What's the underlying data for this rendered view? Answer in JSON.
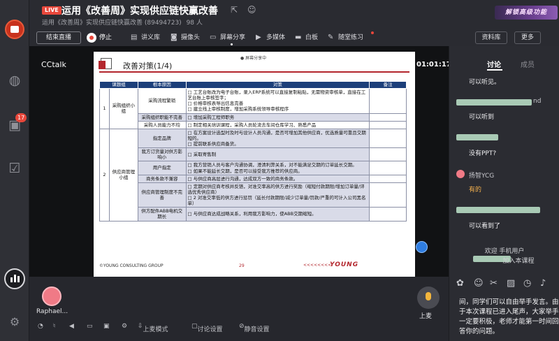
{
  "rail": {
    "badge_count": "17"
  },
  "header": {
    "live_badge": "LIVE",
    "title": "运用《改善周》实现供应链快赢改善",
    "subtitle": "运用《改善周》实现供应链快赢改善 (89494723)",
    "member_count": "98 人",
    "unlock_label": "解锁高级功能"
  },
  "toolbar": {
    "end_live": "结束直播",
    "stop": "停止",
    "courseware": "讲义库",
    "camera": "摄像头",
    "screen_share": "屏幕分享",
    "multimedia": "多媒体",
    "whiteboard": "白板",
    "quiz": "随堂练习",
    "library": "资料库",
    "more": "更多"
  },
  "stage": {
    "brand": "CCtalk",
    "timer": "01:01:17"
  },
  "slide": {
    "title": "改善对策(1/4)",
    "tag": "● 屏幕分享中",
    "headers": [
      "课题组",
      "根本原因",
      "对策",
      "备注"
    ],
    "rows": [
      {
        "group_no": "1",
        "group": "采购组织小组",
        "cause": "采购流程繁琐",
        "actions": [
          "工艺台账改为电子台账，录入ERP系统可以直接复制粘贴，无需物资审核单，直接在工艺台账上审核签字；",
          "价格审核表导出信息完善",
          "建立线上审核制度，增加采购系统领导审核程序"
        ]
      },
      {
        "cause": "采购组织职能不完善",
        "actions": [
          "增加采购工程师职务"
        ]
      },
      {
        "cause": "采购人员能力不均",
        "actions": [
          "制定相关培训课程，采购人员轮流去车间仓库学习、熟悉产品"
        ]
      },
      {
        "group_no": "2",
        "group": "供应商管理小组",
        "cause": "指定品牌",
        "actions": [
          "在方案设计选型时及时与设计人员沟通，是否可增加其他供应商，优选质量可靠且交期短的。",
          "提前联系供应商备货。"
        ]
      },
      {
        "cause": "我方订货量对供方影响小",
        "actions": [
          "采取寄售制"
        ]
      },
      {
        "cause": "用户指定",
        "actions": [
          "我方营销人员与客户沟通协调，澄清利弊关系，对不能满足交期的订单延长交期。",
          "如果不能延长交期，是否可以接受我方推荐的供应商。"
        ]
      },
      {
        "cause": "商务条款不兼容",
        "actions": [
          "与供应商高层进行沟通，达成双方一致的商务条款。"
        ]
      },
      {
        "cause": "供应商管理制度不完善",
        "actions": [
          "定期对供应商考核并反馈，对准交率高的供方进行奖励（缩短付款期限/增加订单量/评选优秀供应商）",
          "2 对准交率低的供方进行惩罚（延长付款期限/减少订单量/罚款/严重的可计入公司黑名单）"
        ]
      },
      {
        "cause": "供方配件ABB电机交期长",
        "actions": [
          "与供应商达成战略关系，利用我方影响力，使ABB交期缩短。"
        ]
      }
    ],
    "footer_left": "©YOUNG CONSULTING GROUP",
    "page_no": "29",
    "chevrons": "<<<<<<<<",
    "brand": "YOUNG"
  },
  "bottom": {
    "user_name": "Raphael...",
    "mic_label": "上麦",
    "mode": "上麦模式",
    "discussion_settings": "讨论设置",
    "mute_settings": "静音设置"
  },
  "panel": {
    "tab_discuss": "讨论",
    "tab_members": "成员",
    "msg1": "可以听见。",
    "name2_tail": "nd",
    "msg2": "可以听到",
    "msg3": "没有PPT?",
    "name4": "扬智YCG",
    "msg4": "有的",
    "msg5": "可以看到了",
    "notice1": "欢迎 手机用户",
    "notice2": "加入本课程",
    "info": "间，同学们可以自由举手发言。由于本次课程已进入尾声，大家举手一定要积极，老师才能第一时间回答你的问题。"
  }
}
